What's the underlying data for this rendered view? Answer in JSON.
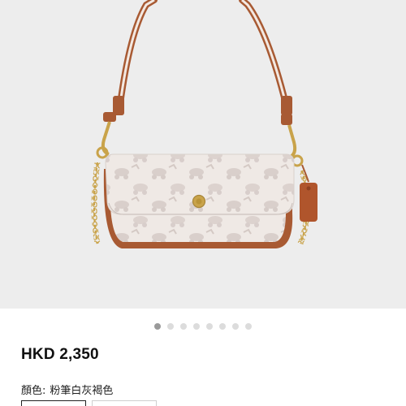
{
  "product": {
    "image_icon": "handbag-product-photo",
    "carousel": {
      "total": 8,
      "active_index": 0
    },
    "price": "HKD 2,350",
    "color": {
      "label": "顏色:",
      "value": "粉筆白灰褐色"
    }
  },
  "colors": {
    "background": "#ededed",
    "dot_active": "#9a9a9a",
    "dot_inactive": "#dcdcdc",
    "leather": "#a85a33",
    "canvas": "#efe9e5",
    "hardware_gold": "#c9a34a"
  }
}
